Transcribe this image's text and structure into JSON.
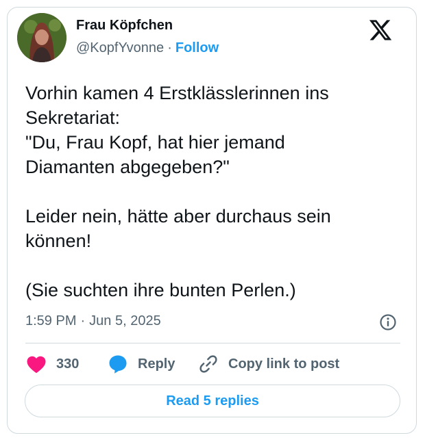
{
  "author": {
    "display_name": "Frau Köpfchen",
    "handle": "@KopfYvonne",
    "separator": "·",
    "follow_label": "Follow"
  },
  "tweet": {
    "text": "Vorhin kamen 4 Erstklässlerinnen ins\nSekretariat:\n\"Du, Frau Kopf, hat hier jemand\nDiamanten abgegeben?\"\n\nLeider nein, hätte aber durchaus sein\nkönnen!\n\n(Sie suchten ihre bunten Perlen.)",
    "time": "1:59 PM",
    "separator": "·",
    "date": "Jun 5, 2025"
  },
  "actions": {
    "like_count": "330",
    "reply_label": "Reply",
    "copy_link_label": "Copy link to post"
  },
  "read_replies_label": "Read 5 replies",
  "icons": {
    "brand": "x-logo-icon",
    "info": "info-icon",
    "like": "heart-icon",
    "reply": "speech-bubble-icon",
    "copy": "link-icon"
  },
  "colors": {
    "accent": "#1d9bf0",
    "like": "#f91880",
    "text": "#0f1419",
    "muted": "#536471",
    "border": "#cfd9de"
  }
}
